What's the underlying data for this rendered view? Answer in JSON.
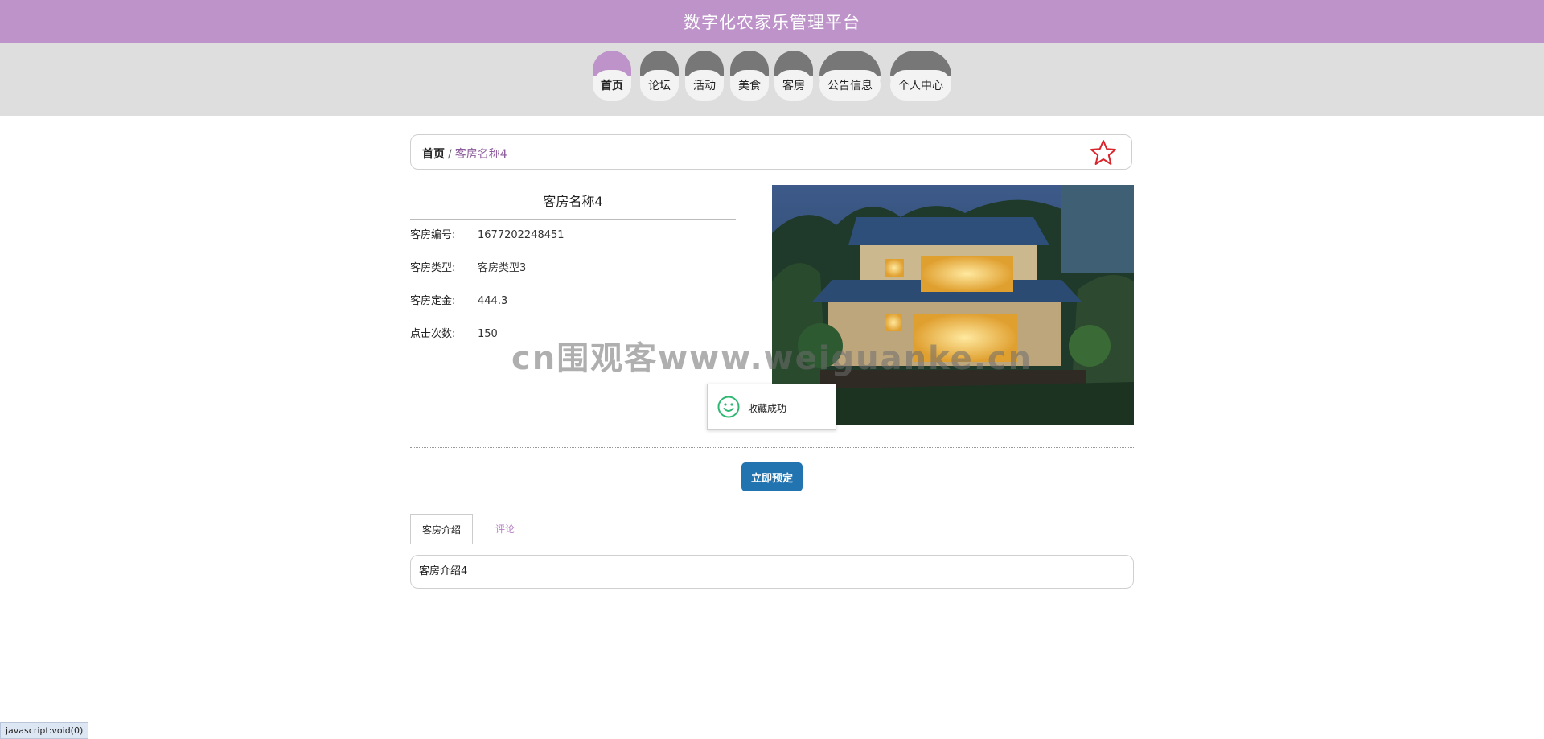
{
  "header": {
    "title": "数字化农家乐管理平台"
  },
  "nav": [
    {
      "label": "首页",
      "active": true
    },
    {
      "label": "论坛",
      "active": false
    },
    {
      "label": "活动",
      "active": false
    },
    {
      "label": "美食",
      "active": false
    },
    {
      "label": "客房",
      "active": false
    },
    {
      "label": "公告信息",
      "active": false
    },
    {
      "label": "个人中心",
      "active": false
    }
  ],
  "breadcrumb": {
    "home": "首页",
    "separator": "/",
    "current": "客房名称4",
    "favorite_icon": "star-outline-icon"
  },
  "room": {
    "name": "客房名称4",
    "fields": [
      {
        "label": "客房编号:",
        "value": "1677202248451"
      },
      {
        "label": "客房类型:",
        "value": "客房类型3"
      },
      {
        "label": "客房定金:",
        "value": "444.3"
      },
      {
        "label": "点击次数:",
        "value": "150"
      }
    ]
  },
  "watermark": "cn围观客www.weiguanke.cn",
  "toast": {
    "icon": "smiley-icon",
    "message": "收藏成功"
  },
  "actions": {
    "book_label": "立即预定"
  },
  "tabs": [
    {
      "label": "客房介绍",
      "active": true
    },
    {
      "label": "评论",
      "active": false
    }
  ],
  "description": "客房介绍4",
  "statusbar": "javascript:void(0)",
  "colors": {
    "header": "#bd93c9",
    "accent": "#8b5a9b",
    "button": "#2174b0",
    "star": "#d9262c"
  }
}
